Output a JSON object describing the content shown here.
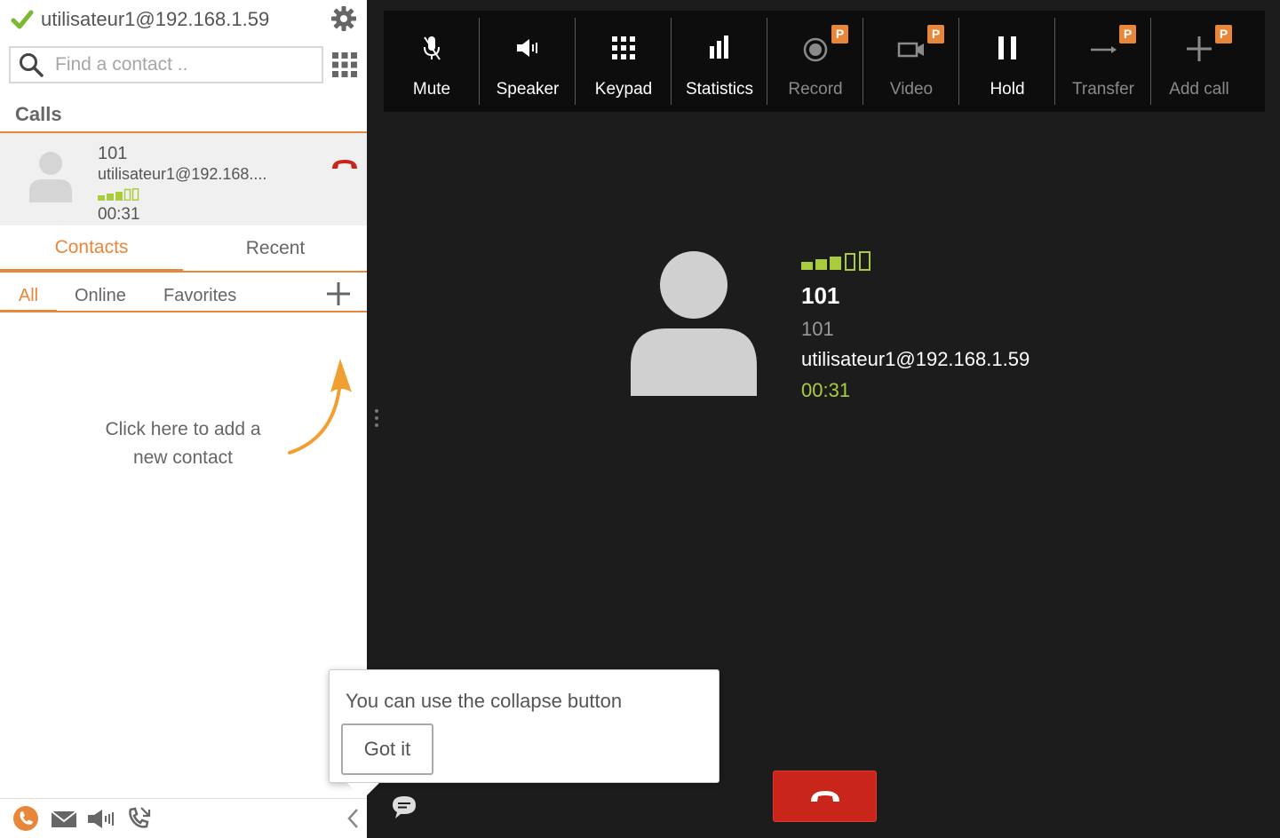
{
  "account": {
    "status": "registered",
    "address": "utilisateur1@192.168.1.59"
  },
  "search": {
    "placeholder": "Find a contact .."
  },
  "calls": {
    "title": "Calls",
    "items": [
      {
        "number": "101",
        "address": "utilisateur1@192.168....",
        "duration": "00:31",
        "signal_bars": 3
      }
    ]
  },
  "tabs": [
    {
      "label": "Contacts",
      "active": true
    },
    {
      "label": "Recent",
      "active": false
    }
  ],
  "filters": [
    {
      "label": "All",
      "active": true
    },
    {
      "label": "Online"
    },
    {
      "label": "Favorites"
    }
  ],
  "hint": {
    "line1": "Click here to add a",
    "line2": "new contact"
  },
  "toolbar": [
    {
      "label": "Mute",
      "icon": "mic-off-icon",
      "premium": false,
      "enabled": true
    },
    {
      "label": "Speaker",
      "icon": "speaker-icon",
      "premium": false,
      "enabled": true
    },
    {
      "label": "Keypad",
      "icon": "keypad-icon",
      "premium": false,
      "enabled": true
    },
    {
      "label": "Statistics",
      "icon": "bar-chart-icon",
      "premium": false,
      "enabled": true
    },
    {
      "label": "Record",
      "icon": "record-icon",
      "premium": true,
      "enabled": false
    },
    {
      "label": "Video",
      "icon": "video-icon",
      "premium": true,
      "enabled": false
    },
    {
      "label": "Hold",
      "icon": "pause-icon",
      "premium": false,
      "enabled": true
    },
    {
      "label": "Transfer",
      "icon": "transfer-arrow-icon",
      "premium": true,
      "enabled": false
    },
    {
      "label": "Add call",
      "icon": "plus-icon",
      "premium": true,
      "enabled": false
    }
  ],
  "premium_badge": "P",
  "active_call": {
    "name": "101",
    "number": "101",
    "address": "utilisateur1@192.168.1.59",
    "duration": "00:31",
    "signal_bars": 3
  },
  "tooltip": {
    "text": "You can use the collapse button",
    "button": "Got it"
  },
  "colors": {
    "accent": "#e8873a",
    "signal": "#a9cc3c",
    "hangup": "#c9251b",
    "background": "#1c1c1c"
  }
}
